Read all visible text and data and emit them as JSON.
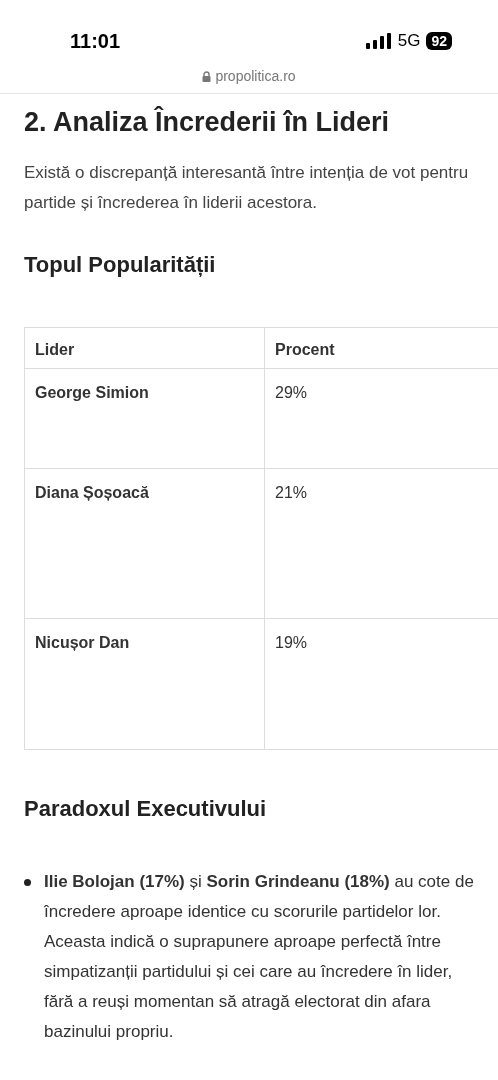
{
  "status_bar": {
    "time": "11:01",
    "network": "5G",
    "battery": "92"
  },
  "address_bar": {
    "url": "propolitica.ro"
  },
  "article": {
    "heading": "2. Analiza Încrederii în Lideri",
    "intro": "Există o discrepanță interesantă între intenția de vot pentru partide și încrederea în liderii acestora.",
    "table_heading": "Topul Popularității",
    "table": {
      "columns": [
        "Lider",
        "Procent"
      ],
      "rows": [
        [
          "George Simion",
          "29%"
        ],
        [
          "Diana Șoșoacă",
          "21%"
        ],
        [
          "Nicușor Dan",
          "19%"
        ]
      ]
    },
    "section_heading": "Paradoxul Executivului",
    "bullets": [
      "**Ilie Bolojan (17%)** și **Sorin Grindeanu (18%)** au cote de încredere aproape identice cu scorurile partidelor lor. Aceasta indică o suprapunere aproape perfectă între simpatizanții partidului și cei care au încredere în lider, fără a reuși momentan să atragă electorat din afara bazinului propriu."
    ]
  }
}
